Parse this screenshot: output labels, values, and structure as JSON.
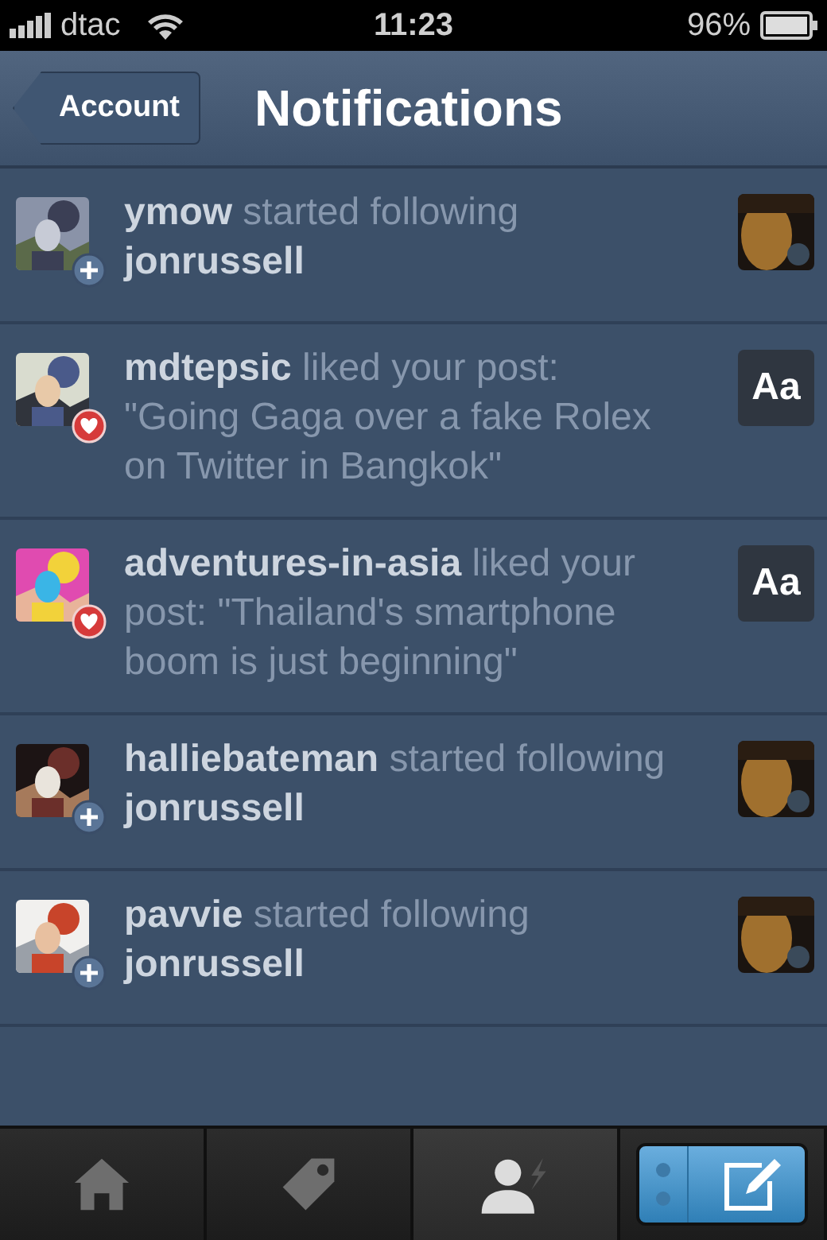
{
  "status_bar": {
    "carrier": "dtac",
    "time": "11:23",
    "battery": "96%"
  },
  "nav": {
    "back": "Account",
    "title": "Notifications"
  },
  "notifications": [
    {
      "kind": "follow",
      "text": "**ymow** started following **jonrussell**"
    },
    {
      "kind": "like",
      "text": "**mdtepsic** liked your post: \"Going Gaga over a fake Rolex on Twitter in Bangkok\"",
      "thumb": {
        "kind": "text",
        "label": "Aa"
      }
    },
    {
      "kind": "like",
      "text": "**adventures-in-asia** liked your post: \"Thailand's smartphone boom is just beginning\"",
      "thumb": {
        "kind": "text",
        "label": "Aa"
      }
    },
    {
      "kind": "follow",
      "text": "**halliebateman** started following **jonrussell**"
    },
    {
      "kind": "follow",
      "text": "**pavvie** started following **jonrussell**"
    }
  ],
  "tab_bar": [
    {
      "kind": "home",
      "selected": false
    },
    {
      "kind": "tag",
      "selected": false
    },
    {
      "kind": "activity",
      "selected": true
    },
    {
      "kind": "compose",
      "selected": false
    }
  ]
}
